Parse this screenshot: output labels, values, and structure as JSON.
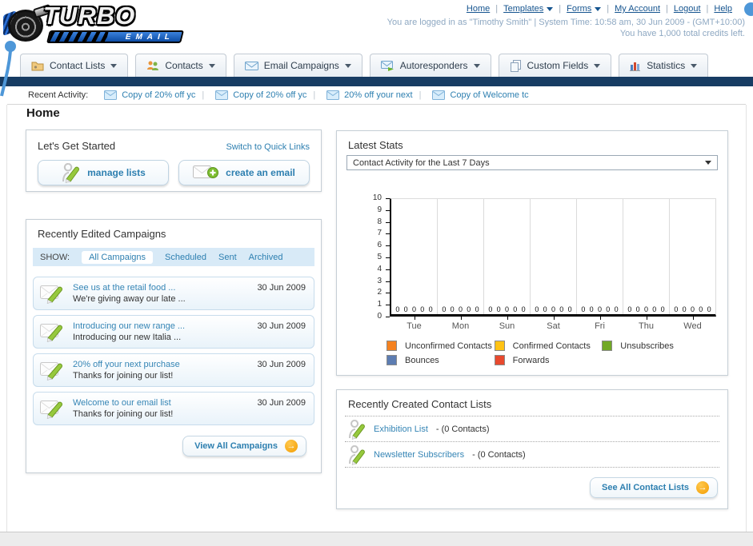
{
  "header": {
    "logo": {
      "title": "TURBO",
      "subtitle": "EMAIL"
    },
    "nav_links": [
      "Home",
      "Templates",
      "Forms",
      "My Account",
      "Logout",
      "Help"
    ],
    "login_line": "You are logged in as \"Timothy Smith\" | System Time: 10:58 am, 30 Jun 2009 - (GMT+10:00)",
    "credits_line": "You have 1,000 total credits left."
  },
  "tabs": [
    {
      "label": "Contact Lists",
      "icon": "folder-icon"
    },
    {
      "label": "Contacts",
      "icon": "contacts-icon"
    },
    {
      "label": "Email Campaigns",
      "icon": "envelope-icon"
    },
    {
      "label": "Autoresponders",
      "icon": "autoresponder-icon"
    },
    {
      "label": "Custom Fields",
      "icon": "pages-icon"
    },
    {
      "label": "Statistics",
      "icon": "bar-chart-icon"
    }
  ],
  "recent_activity": {
    "label": "Recent Activity:",
    "items": [
      "Copy of 20% off yc",
      "Copy of 20% off yc",
      "20% off your next ",
      "Copy of Welcome tc"
    ]
  },
  "page_title": "Home",
  "get_started": {
    "title": "Let's Get Started",
    "switch_link": "Switch to Quick Links",
    "manage_lists_label": "manage lists",
    "create_email_label": "create an email"
  },
  "campaigns": {
    "title": "Recently Edited Campaigns",
    "show_label": "SHOW:",
    "filters": [
      "All Campaigns",
      "Scheduled",
      "Sent",
      "Archived"
    ],
    "active_filter": "All Campaigns",
    "items": [
      {
        "title": "See us at the retail food ...",
        "subtitle": "We're giving away our late ...",
        "date": "30 Jun 2009"
      },
      {
        "title": "Introducing our new range ...",
        "subtitle": "Introducing our new Italia ...",
        "date": "30 Jun 2009"
      },
      {
        "title": "20% off your next purchase",
        "subtitle": "Thanks for joining our list!",
        "date": "30 Jun 2009"
      },
      {
        "title": "Welcome to our email list",
        "subtitle": "Thanks for joining our list!",
        "date": "30 Jun 2009"
      }
    ],
    "view_all_label": "View All Campaigns"
  },
  "stats": {
    "title": "Latest Stats",
    "dropdown_value": "Contact Activity for the Last 7 Days"
  },
  "chart_data": {
    "type": "bar",
    "title": "Contact Activity for the Last 7 Days",
    "categories": [
      "Tue",
      "Mon",
      "Sun",
      "Sat",
      "Fri",
      "Thu",
      "Wed"
    ],
    "series": [
      {
        "name": "Unconfirmed Contacts",
        "color": "#F58220",
        "values": [
          0,
          0,
          0,
          0,
          0,
          0,
          0
        ]
      },
      {
        "name": "Confirmed Contacts",
        "color": "#FFC214",
        "values": [
          0,
          0,
          0,
          0,
          0,
          0,
          0
        ]
      },
      {
        "name": "Unsubscribes",
        "color": "#71A826",
        "values": [
          0,
          0,
          0,
          0,
          0,
          0,
          0
        ]
      },
      {
        "name": "Bounces",
        "color": "#5D7DB2",
        "values": [
          0,
          0,
          0,
          0,
          0,
          0,
          0
        ]
      },
      {
        "name": "Forwards",
        "color": "#E8492E",
        "values": [
          0,
          0,
          0,
          0,
          0,
          0,
          0
        ]
      }
    ],
    "xlabel": "",
    "ylabel": "",
    "ylim": [
      0,
      10
    ],
    "yticks": [
      0,
      1,
      2,
      3,
      4,
      5,
      6,
      7,
      8,
      9,
      10
    ],
    "grid": true,
    "legend_position": "bottom",
    "value_labels_shown": true
  },
  "contact_lists": {
    "title": "Recently Created Contact Lists",
    "items": [
      {
        "name": "Exhibition List",
        "detail": "- (0 Contacts)"
      },
      {
        "name": "Newsletter Subscribers",
        "detail": "- (0 Contacts)"
      }
    ],
    "see_all_label": "See All Contact Lists"
  }
}
